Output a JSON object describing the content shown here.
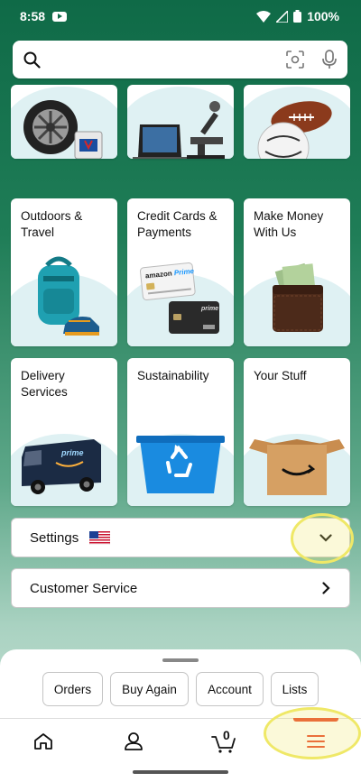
{
  "status_bar": {
    "time": "8:58",
    "battery": "100%"
  },
  "search": {
    "placeholder": ""
  },
  "tiles": [
    {
      "label": "",
      "icon": "auto-wheel-icon"
    },
    {
      "label": "",
      "icon": "laptop-microscope-icon"
    },
    {
      "label": "",
      "icon": "sports-balls-icon"
    },
    {
      "label": "Outdoors & Travel",
      "icon": "backpack-icon"
    },
    {
      "label": "Credit Cards & Payments",
      "icon": "credit-card-icon"
    },
    {
      "label": "Make Money With Us",
      "icon": "wallet-icon"
    },
    {
      "label": "Delivery Services",
      "icon": "delivery-van-icon"
    },
    {
      "label": "Sustainability",
      "icon": "recycle-bin-icon"
    },
    {
      "label": "Your Stuff",
      "icon": "box-icon"
    }
  ],
  "settings": {
    "label": "Settings",
    "flag": "us-flag-icon"
  },
  "customer_service": {
    "label": "Customer Service"
  },
  "chips": [
    "Orders",
    "Buy Again",
    "Account",
    "Lists"
  ],
  "bottom_nav": {
    "cart_count": "0",
    "icons": [
      "home-icon",
      "account-icon",
      "cart-icon",
      "menu-icon"
    ],
    "active": "menu"
  },
  "colors": {
    "header_green": "#0f6a47",
    "accent_orange": "#e8482b",
    "highlight_yellow": "#efe867",
    "tile_arc": "#dff1f3"
  }
}
